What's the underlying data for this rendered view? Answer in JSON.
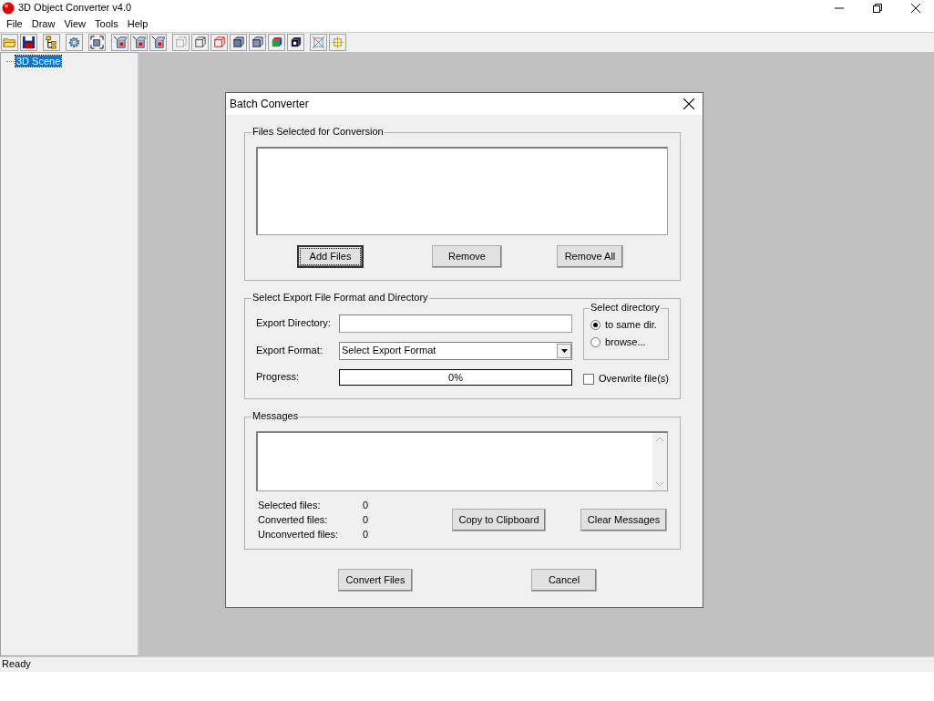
{
  "window": {
    "title": "3D Object Converter v4.0"
  },
  "menu": [
    {
      "label": "File"
    },
    {
      "label": "Draw"
    },
    {
      "label": "View"
    },
    {
      "label": "Tools"
    },
    {
      "label": "Help"
    }
  ],
  "toolbar": {
    "groups": [
      [
        {
          "kind": "open"
        },
        {
          "kind": "save"
        }
      ],
      [
        {
          "kind": "tree"
        }
      ],
      [
        {
          "kind": "gear"
        }
      ],
      [
        {
          "kind": "fit"
        }
      ],
      [
        {
          "kind": "axis"
        },
        {
          "kind": "axis"
        },
        {
          "kind": "axis"
        }
      ],
      [
        {
          "kind": "dotted"
        },
        {
          "kind": "wire"
        },
        {
          "kind": "redwire"
        },
        {
          "kind": "solid"
        },
        {
          "kind": "shaded"
        },
        {
          "kind": "color"
        },
        {
          "kind": "dark"
        }
      ],
      [
        {
          "kind": "bbox"
        },
        {
          "kind": "center"
        }
      ]
    ]
  },
  "tree": {
    "items": [
      {
        "label": "3D Scene",
        "selected": true
      }
    ]
  },
  "dialog": {
    "title": "Batch Converter",
    "files_group": {
      "legend": "Files Selected for Conversion",
      "buttons": [
        {
          "label": "Add Files",
          "focused": true
        },
        {
          "label": "Remove",
          "focused": false
        },
        {
          "label": "Remove All",
          "focused": false
        }
      ]
    },
    "export_group": {
      "legend": "Select Export File Format and Directory",
      "directory_label": "Export Directory:",
      "format_label": "Export Format:",
      "format_value": "Select Export Format",
      "progress_label": "Progress:",
      "progress": {
        "level": 0,
        "reading": "0%"
      },
      "directory_options": {
        "legend": "Select directory",
        "options": [
          {
            "label": "to same dir.",
            "selected": true
          },
          {
            "label": "browse...",
            "selected": false
          }
        ]
      },
      "overwrite": {
        "label": "Overwrite file(s)",
        "checked": false
      }
    },
    "messages_group": {
      "legend": "Messages",
      "stats": [
        {
          "label": "Selected files:",
          "value": "0"
        },
        {
          "label": "Converted files:",
          "value": "0"
        },
        {
          "label": "Unconverted files:",
          "value": "0"
        }
      ],
      "buttons": [
        {
          "label": "Copy to Clipboard",
          "focused": false
        },
        {
          "label": "Clear Messages",
          "focused": false
        }
      ]
    },
    "buttons": [
      {
        "label": "Convert Files",
        "focused": false
      },
      {
        "label": "Cancel",
        "focused": false
      }
    ]
  },
  "status_bar": {
    "text": "Ready"
  }
}
